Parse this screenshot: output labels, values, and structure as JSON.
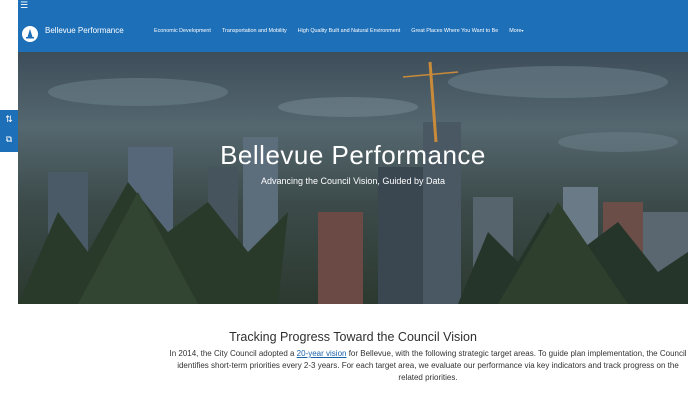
{
  "header": {
    "hamburger_icon": "menu-icon",
    "logo_icon": "city-logo-icon",
    "brand": "Bellevue Performance",
    "nav": [
      "Economic Development",
      "Transportation and Mobility",
      "High Quality Built and Natural Environment",
      "Great Places Where You Want to Be",
      "More"
    ],
    "more_caret": "▾",
    "bar_color": "#1d6fb8"
  },
  "side_tools": {
    "items": [
      {
        "icon": "share-icon",
        "glyph": "⇅"
      },
      {
        "icon": "open-external-icon",
        "glyph": "⧉"
      }
    ]
  },
  "hero": {
    "title": "Bellevue Performance",
    "subtitle": "Advancing the Council Vision, Guided by Data"
  },
  "main": {
    "heading": "Tracking Progress Toward the Council Vision",
    "intro_before": "In 2014, the City Council adopted a ",
    "intro_link": "20-year vision",
    "intro_after": " for Bellevue, with the following strategic target areas. To guide plan implementation, the Council identifies short-term priorities every 2-3 years. For each target area, we evaluate our performance via key indicators and track progress on the related priorities.",
    "link_color": "#1a61a8"
  }
}
